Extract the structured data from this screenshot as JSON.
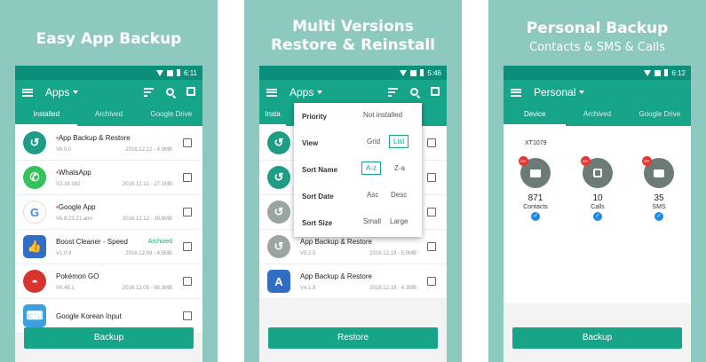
{
  "colors": {
    "panel_bg": "#8ec9bf",
    "accent": "#17a589",
    "status_bar": "#0b8f7b"
  },
  "panel1": {
    "caption": "Easy App Backup",
    "status_time": "6:11",
    "toolbar_title": "Apps",
    "tabs": [
      "Installed",
      "Archived",
      "Google Drive"
    ],
    "apps": [
      {
        "name": "App Backup & Restore",
        "version": "V6.0.0",
        "date_size": "2016.12.12 - 4.9MB",
        "icon": "backup-icon",
        "starred": true
      },
      {
        "name": "WhatsApp",
        "version": "V2.16.392",
        "date_size": "2016.12.12 - 27.1MB",
        "icon": "whatsapp-icon",
        "starred": true
      },
      {
        "name": "Google App",
        "version": "V6.8.23.21.arm",
        "date_size": "2016.12.12 - 39.9MB",
        "icon": "google-icon",
        "starred": true
      },
      {
        "name": "Boost Cleaner - Speed",
        "version": "V1.0.4",
        "date_size": "2016.12.09 - 4.5MB",
        "icon": "boost-icon",
        "starred": false,
        "tag": "Archived"
      },
      {
        "name": "Pokémon GO",
        "version": "V0.49.1",
        "date_size": "2016.12.09 - 88.3MB",
        "icon": "pokeball-icon",
        "starred": false
      },
      {
        "name": "Google Korean Input",
        "version": "",
        "date_size": "",
        "icon": "keyboard-icon",
        "starred": false
      }
    ],
    "button": "Backup"
  },
  "panel2": {
    "caption_line1": "Multi Versions",
    "caption_line2": "Restore & Reinstall",
    "status_time": "5:46",
    "toolbar_title": "Apps",
    "tab_fragment": "Insta",
    "popup": [
      {
        "label": "Priority",
        "options": [
          "Not installed"
        ],
        "selected": -1
      },
      {
        "label": "View",
        "options": [
          "Grid",
          "List"
        ],
        "selected": 1
      },
      {
        "label": "Sort Name",
        "options": [
          "A-z",
          "Z-a"
        ],
        "selected": 0
      },
      {
        "label": "Sort Date",
        "options": [
          "Asc",
          "Desc"
        ],
        "selected": -1
      },
      {
        "label": "Sort Size",
        "options": [
          "Small",
          "Large"
        ],
        "selected": -1
      }
    ],
    "apps": [
      {
        "name": "App Backup & Restore",
        "version": "V5.2.5",
        "date_size": "2016.12.19 - 5.9MB"
      },
      {
        "name": "App Backup & Restore",
        "version": "V4.1.9",
        "date_size": "2016.12.19 - 4.3MB"
      }
    ],
    "button": "Restore"
  },
  "panel3": {
    "caption_line1": "Personal Backup",
    "caption_line2": "Contacts & SMS & Calls",
    "status_time": "6:12",
    "toolbar_title": "Personal",
    "tabs": [
      "Device",
      "Archived",
      "Google Drive"
    ],
    "device_id": "XT1079",
    "counts": [
      {
        "value": "871",
        "label": "Contacts",
        "icon": "contacts-icon"
      },
      {
        "value": "10",
        "label": "Calls",
        "icon": "phone-icon"
      },
      {
        "value": "35",
        "label": "SMS",
        "icon": "sms-icon"
      }
    ],
    "button": "Backup"
  }
}
